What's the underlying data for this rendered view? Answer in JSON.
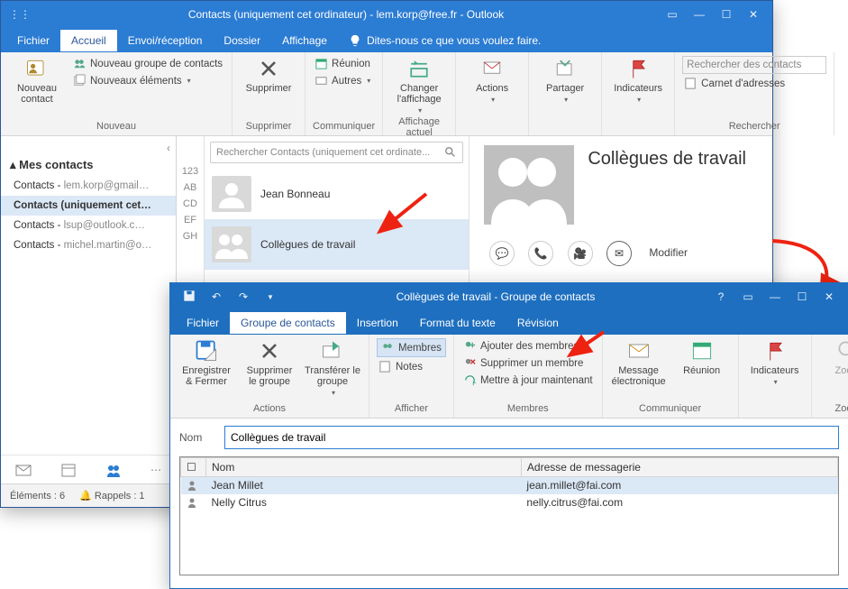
{
  "colors": {
    "brand": "#2b7cd3",
    "brand2": "#1e6fbf",
    "ribbon": "#f3f3f3"
  },
  "win1": {
    "title": "Contacts (uniquement cet ordinateur) - lem.korp@free.fr - Outlook",
    "tabs": {
      "fichier": "Fichier",
      "accueil": "Accueil",
      "envoi": "Envoi/réception",
      "dossier": "Dossier",
      "affichage": "Affichage",
      "tell": "Dites-nous ce que vous voulez faire."
    },
    "ribbon": {
      "nouveau": {
        "label": "Nouveau",
        "contact": "Nouveau\ncontact",
        "groupe": "Nouveau groupe de contacts",
        "elements": "Nouveaux éléments"
      },
      "supprimer": {
        "label": "Supprimer",
        "btn": "Supprimer"
      },
      "communiquer": {
        "label": "Communiquer",
        "reunion": "Réunion",
        "autres": "Autres"
      },
      "affcur": {
        "label": "Affichage actuel",
        "changer": "Changer\nl'affichage"
      },
      "actions": {
        "label": "",
        "btn": "Actions"
      },
      "partager": {
        "label": "",
        "btn": "Partager"
      },
      "indic": {
        "label": "",
        "btn": "Indicateurs"
      },
      "rechercher": {
        "label": "Rechercher",
        "placeholder": "Rechercher des contacts",
        "carnet": "Carnet d'adresses"
      }
    },
    "nav": {
      "header": "Mes contacts",
      "items": [
        {
          "a": "Contacts - ",
          "b": "lem.korp@gmail…"
        },
        {
          "a": "Contacts (uniquement cet…",
          "b": ""
        },
        {
          "a": "Contacts - ",
          "b": "lsup@outlook.c…"
        },
        {
          "a": "Contacts - ",
          "b": "michel.martin@o…"
        }
      ]
    },
    "az": [
      "123",
      "AB",
      "CD",
      "EF",
      "GH"
    ],
    "search": "Rechercher Contacts (uniquement cet ordinate...",
    "contacts": [
      {
        "name": "Jean Bonneau"
      },
      {
        "name": "Collègues de travail"
      }
    ],
    "preview": {
      "title": "Collègues de travail",
      "modifier": "Modifier"
    },
    "status": {
      "elements": "Éléments : 6",
      "rappels": "Rappels : 1"
    }
  },
  "win2": {
    "title": "Collègues de travail - Groupe de contacts",
    "tabs": {
      "fichier": "Fichier",
      "groupe": "Groupe de contacts",
      "insertion": "Insertion",
      "format": "Format du texte",
      "revision": "Révision"
    },
    "ribbon": {
      "actions": {
        "label": "Actions",
        "enr": "Enregistrer\n& Fermer",
        "supg": "Supprimer\nle groupe",
        "trans": "Transférer le\ngroupe"
      },
      "afficher": {
        "label": "Afficher",
        "membres": "Membres",
        "notes": "Notes"
      },
      "membres": {
        "label": "Membres",
        "ajouter": "Ajouter des membres",
        "supm": "Supprimer un membre",
        "maj": "Mettre à jour maintenant"
      },
      "comm": {
        "label": "Communiquer",
        "msg": "Message\nélectronique",
        "reunion": "Réunion"
      },
      "indic": {
        "label": "",
        "btn": "Indicateurs"
      },
      "zoom": {
        "label": "Zoom",
        "btn": "Zoom"
      }
    },
    "field": {
      "label": "Nom",
      "value": "Collègues de travail"
    },
    "grid": {
      "cols": {
        "nom": "Nom",
        "adr": "Adresse de messagerie"
      },
      "rows": [
        {
          "nom": "Jean Millet",
          "adr": "jean.millet@fai.com"
        },
        {
          "nom": "Nelly Citrus",
          "adr": "nelly.citrus@fai.com"
        }
      ]
    }
  }
}
